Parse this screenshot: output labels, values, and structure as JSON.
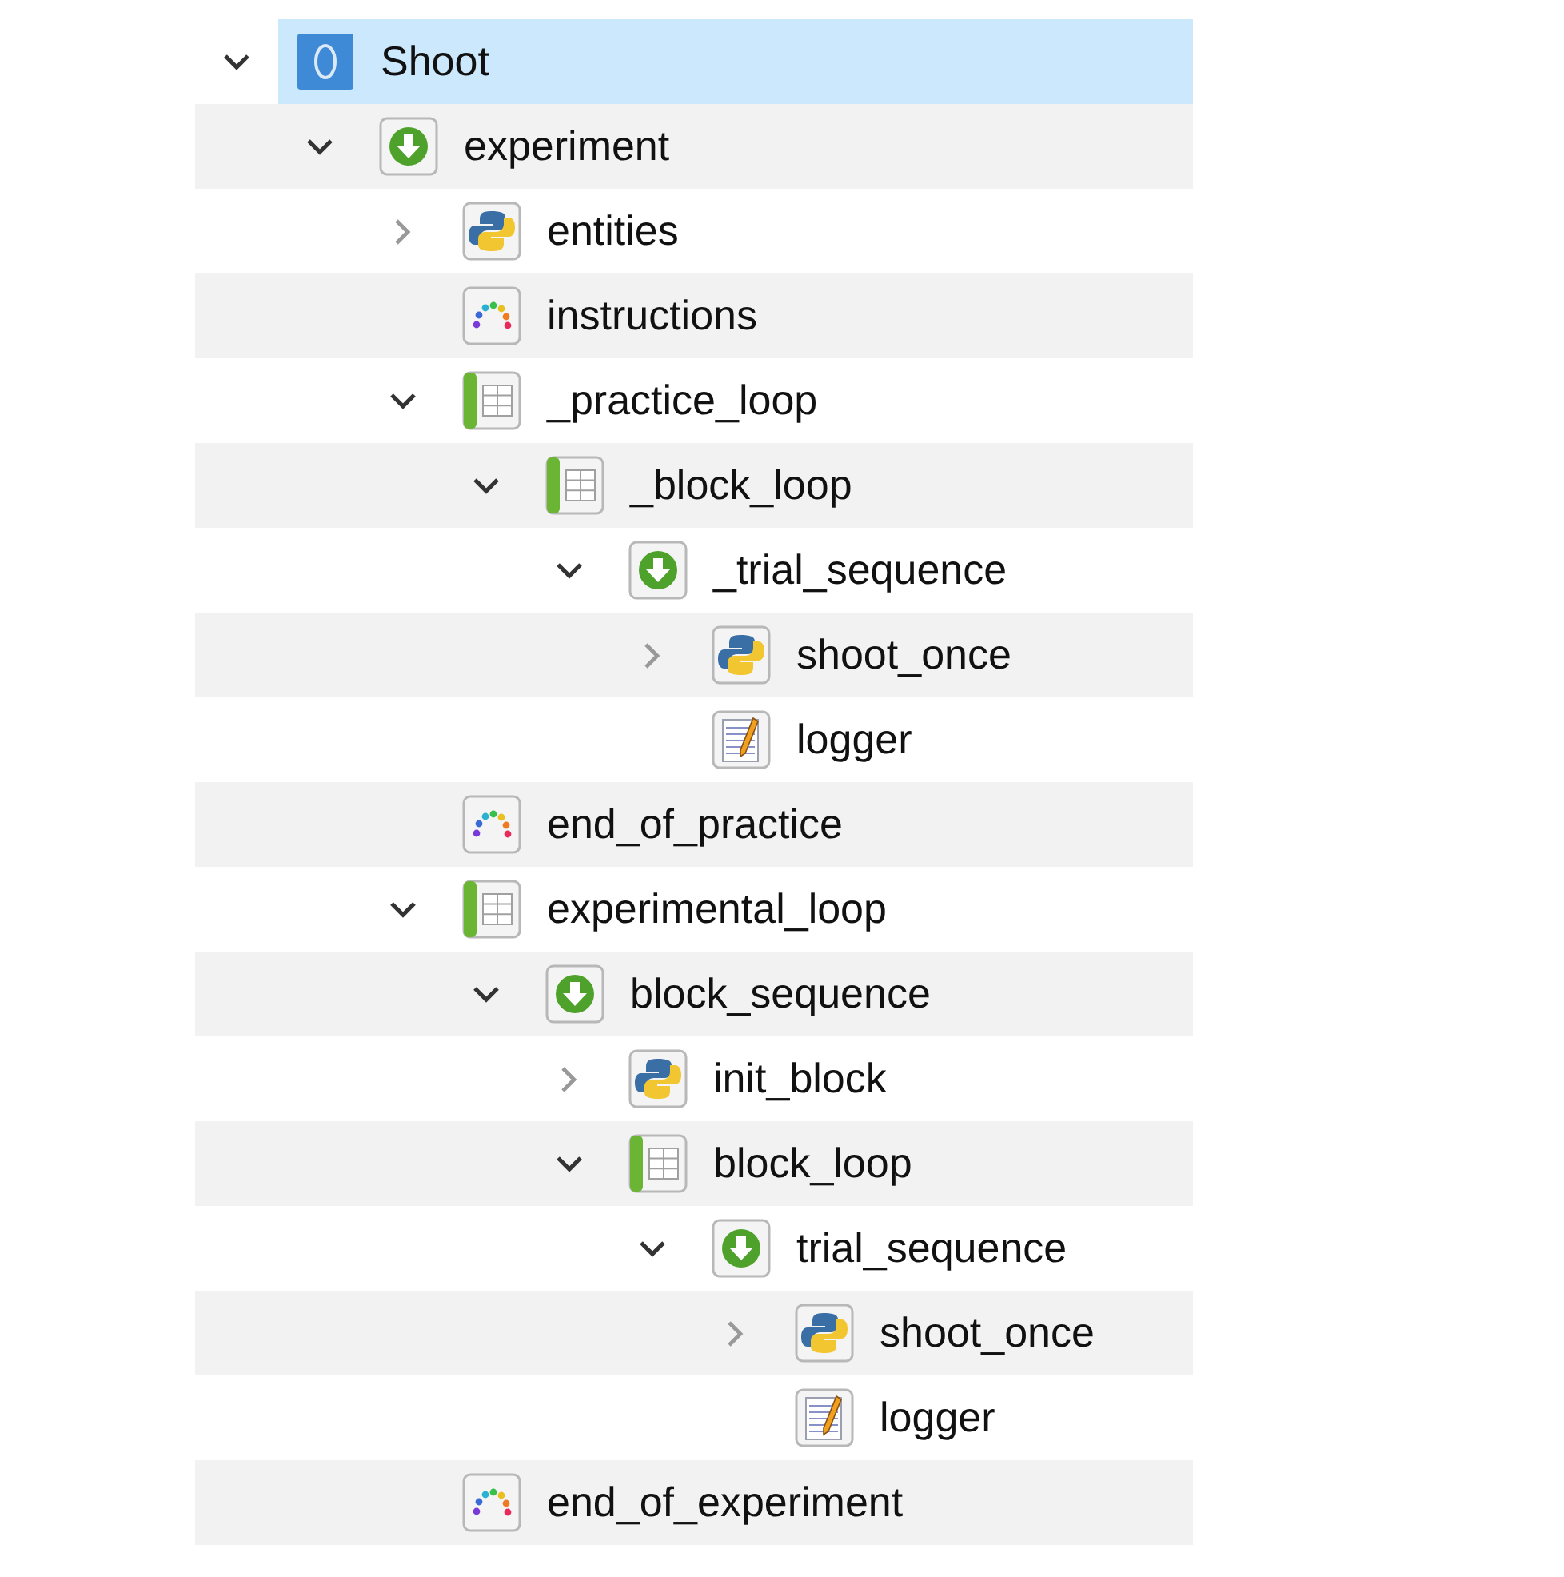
{
  "tree": {
    "items": [
      {
        "label": "Shoot",
        "kind": "experiment",
        "selected": true,
        "expanded": true,
        "children": [
          {
            "label": "experiment",
            "kind": "sequence",
            "selected": false,
            "expanded": true,
            "children": [
              {
                "label": "entities",
                "kind": "inline_script",
                "selected": false,
                "expanded": false
              },
              {
                "label": "instructions",
                "kind": "sketchpad",
                "selected": false
              },
              {
                "label": "_practice_loop",
                "kind": "loop",
                "selected": false,
                "expanded": true,
                "children": [
                  {
                    "label": "_block_loop",
                    "kind": "loop",
                    "selected": false,
                    "expanded": true,
                    "children": [
                      {
                        "label": "_trial_sequence",
                        "kind": "sequence",
                        "selected": false,
                        "expanded": true,
                        "children": [
                          {
                            "label": "shoot_once",
                            "kind": "inline_script",
                            "selected": false,
                            "expanded": false
                          },
                          {
                            "label": "logger",
                            "kind": "logger",
                            "selected": false
                          }
                        ]
                      }
                    ]
                  }
                ]
              },
              {
                "label": "end_of_practice",
                "kind": "sketchpad",
                "selected": false
              },
              {
                "label": "experimental_loop",
                "kind": "loop",
                "selected": false,
                "expanded": true,
                "children": [
                  {
                    "label": "block_sequence",
                    "kind": "sequence",
                    "selected": false,
                    "expanded": true,
                    "children": [
                      {
                        "label": "init_block",
                        "kind": "inline_script",
                        "selected": false,
                        "expanded": false
                      },
                      {
                        "label": "block_loop",
                        "kind": "loop",
                        "selected": false,
                        "expanded": true,
                        "children": [
                          {
                            "label": "trial_sequence",
                            "kind": "sequence",
                            "selected": false,
                            "expanded": true,
                            "children": [
                              {
                                "label": "shoot_once",
                                "kind": "inline_script",
                                "selected": false,
                                "expanded": false
                              },
                              {
                                "label": "logger",
                                "kind": "logger",
                                "selected": false
                              }
                            ]
                          }
                        ]
                      }
                    ]
                  }
                ]
              },
              {
                "label": "end_of_experiment",
                "kind": "sketchpad",
                "selected": false
              }
            ]
          }
        ]
      }
    ]
  }
}
